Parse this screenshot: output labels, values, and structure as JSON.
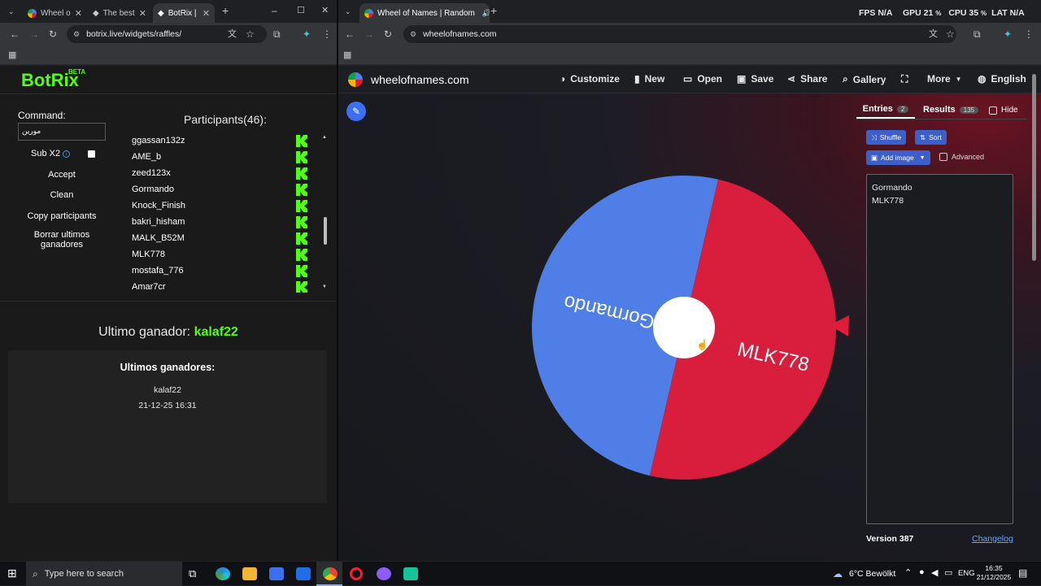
{
  "left_window": {
    "tabs": [
      {
        "label": "Wheel o",
        "active": false
      },
      {
        "label": "The best",
        "active": false
      },
      {
        "label": "BotRix | ",
        "active": true
      }
    ],
    "url": "botrix.live/widgets/raffles/"
  },
  "botrix": {
    "logo": "BotRix",
    "logo_badge": "BETA",
    "command_label": "Command:",
    "command_value": "مورين",
    "sub_label": "Sub X2",
    "accept": "Accept",
    "clean": "Clean",
    "copy": "Copy participants",
    "borrar": "Borrar ultimos ganadores",
    "participants_title": "Participants(46):",
    "participants": [
      "ggassan132z",
      "AME_b",
      "zeed123x",
      "Gormando",
      "Knock_Finish",
      "bakri_hisham",
      "MALK_B52M",
      "MLK778",
      "mostafa_776",
      "Amar7cr"
    ],
    "ultimo_label": "Ultimo ganador:",
    "ultimo_value": "kalaf22",
    "ultimos_title": "Ultimos ganadores:",
    "ultimos_name": "kalaf22",
    "ultimos_date": "21-12-25 16:31"
  },
  "right_window": {
    "tab_label": "Wheel of Names | Random",
    "url": "wheelofnames.com",
    "stats": {
      "fps_label": "FPS",
      "fps_value": "N/A",
      "gpu_label": "GPU",
      "gpu_value": "21",
      "cpu_label": "CPU",
      "cpu_value": "35",
      "lat_label": "LAT",
      "lat_value": "N/A"
    }
  },
  "won": {
    "site": "wheelofnames.com",
    "nav": {
      "customize": "Customize",
      "new": "New",
      "open": "Open",
      "save": "Save",
      "share": "Share",
      "gallery": "Gallery",
      "more": "More",
      "language": "English"
    },
    "tabs": {
      "entries": "Entries",
      "entries_count": "2",
      "results": "Results",
      "results_count": "135",
      "hide": "Hide"
    },
    "shuffle": "Shuffle",
    "sort": "Sort",
    "add_image": "Add image",
    "advanced": "Advanced",
    "entries": [
      "Gormando",
      "MLK778"
    ],
    "version": "Version 387",
    "changelog": "Changelog",
    "wheel": {
      "slices": [
        "Gormando",
        "MLK778"
      ],
      "colors": [
        "#4e7ee6",
        "#d91d3c"
      ]
    }
  },
  "taskbar": {
    "search_placeholder": "Type here to search",
    "weather": "6°C  Bewölkt",
    "lang": "ENG",
    "time": "16:35",
    "date": "21/12/2025"
  },
  "colors": {
    "kick_green": "#53fc18",
    "accent_blue": "#3d5fc9"
  }
}
